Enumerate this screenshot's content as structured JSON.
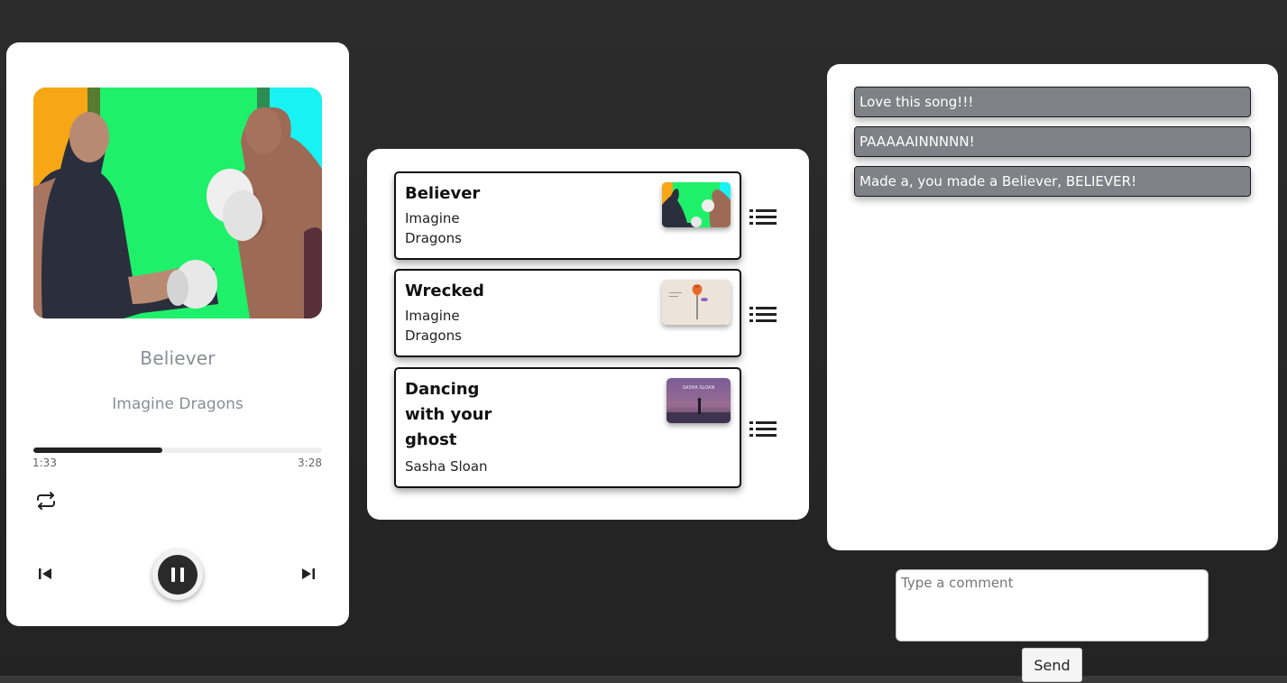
{
  "player": {
    "title": "Believer",
    "artist": "Imagine Dragons",
    "current_time": "1:33",
    "total_time": "3:28",
    "progress_fraction": 0.447,
    "controls": {
      "repeat": "repeat-icon",
      "previous": "skip-previous-icon",
      "play_pause": "pause-icon",
      "next": "skip-next-icon"
    }
  },
  "playlist": {
    "songs": [
      {
        "title": "Believer",
        "artist": "Imagine Dragons",
        "menu_icon": "list-icon"
      },
      {
        "title": "Wrecked",
        "artist": "Imagine Dragons",
        "menu_icon": "list-icon"
      },
      {
        "title": "Dancing with your ghost",
        "artist": "Sasha Sloan",
        "thumb_text": "SASHA SLOAN",
        "menu_icon": "list-icon"
      }
    ]
  },
  "comments": {
    "items": [
      "Love this song!!!",
      "PAAAAAINNNNN!",
      "Made a, you made a Believer, BELIEVER!"
    ],
    "input_placeholder": "Type a comment",
    "send_label": "Send"
  },
  "colors": {
    "background": "#2a2a2a",
    "card": "#ffffff",
    "comment_bubble": "#808186",
    "progress_fill": "#222222",
    "muted_text": "#8a8d93"
  }
}
